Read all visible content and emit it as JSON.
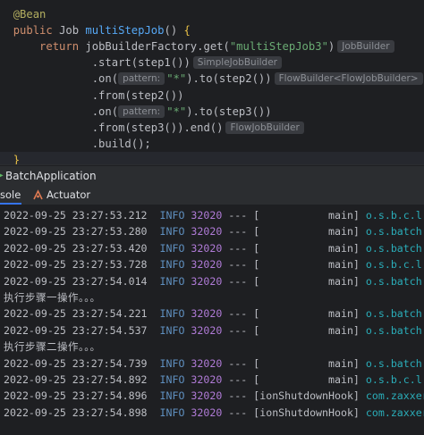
{
  "editor": {
    "lines": [
      {
        "parts": [
          {
            "t": "  ",
            "c": "id"
          },
          {
            "t": "@Bean",
            "c": "ann"
          }
        ]
      },
      {
        "parts": [
          {
            "t": "  ",
            "c": "id"
          },
          {
            "t": "public ",
            "c": "kw"
          },
          {
            "t": "Job ",
            "c": "id"
          },
          {
            "t": "multiStepJob",
            "c": "fn"
          },
          {
            "t": "() ",
            "c": "id"
          },
          {
            "t": "{",
            "c": "brk"
          }
        ]
      },
      {
        "parts": [
          {
            "t": "      ",
            "c": "id"
          },
          {
            "t": "return ",
            "c": "kw"
          },
          {
            "t": "jobBuilderFactory",
            "c": "id"
          },
          {
            "t": ".get(",
            "c": "id"
          },
          {
            "t": "\"multiStepJob3\"",
            "c": "str"
          },
          {
            "t": ")",
            "c": "id"
          },
          {
            "t": "JobBuilder",
            "c": "hint type"
          }
        ]
      },
      {
        "parts": [
          {
            "t": "              .start(step1())",
            "c": "id"
          },
          {
            "t": "SimpleJobBuilder",
            "c": "hint type"
          }
        ]
      },
      {
        "parts": [
          {
            "t": "              .on(",
            "c": "id"
          },
          {
            "t": "pattern:",
            "c": "hint param"
          },
          {
            "t": "\"*\"",
            "c": "str"
          },
          {
            "t": ").to(step2())",
            "c": "id"
          },
          {
            "t": "FlowBuilder<FlowJobBuilder>",
            "c": "hint type"
          }
        ]
      },
      {
        "parts": [
          {
            "t": "              .from(step2())",
            "c": "id"
          }
        ]
      },
      {
        "parts": [
          {
            "t": "              .on(",
            "c": "id"
          },
          {
            "t": "pattern:",
            "c": "hint param"
          },
          {
            "t": "\"*\"",
            "c": "str"
          },
          {
            "t": ").to(step3())",
            "c": "id"
          }
        ]
      },
      {
        "parts": [
          {
            "t": "              .from(step3()).end()",
            "c": "id"
          },
          {
            "t": "FlowJobBuilder",
            "c": "hint type"
          }
        ]
      },
      {
        "parts": [
          {
            "t": "              .build();",
            "c": "id"
          }
        ]
      },
      {
        "parts": [
          {
            "t": "  ",
            "c": "id"
          },
          {
            "t": "}",
            "c": "brk"
          }
        ]
      }
    ]
  },
  "run_window": {
    "title": "BatchApplication",
    "tabs": [
      {
        "label": "sole",
        "active": true
      },
      {
        "label": "Actuator",
        "active": false
      }
    ]
  },
  "console": {
    "rows": [
      {
        "type": "log",
        "ts": "2022-09-25 23:27:53.212",
        "level": "INFO",
        "pid": "32020",
        "sep": "---",
        "thread": "[           main]",
        "logger": "o.s.b.c.l.sup"
      },
      {
        "type": "log",
        "ts": "2022-09-25 23:27:53.280",
        "level": "INFO",
        "pid": "32020",
        "sep": "---",
        "thread": "[           main]",
        "logger": "o.s.batch.cor"
      },
      {
        "type": "log",
        "ts": "2022-09-25 23:27:53.420",
        "level": "INFO",
        "pid": "32020",
        "sep": "---",
        "thread": "[           main]",
        "logger": "o.s.batch.cor"
      },
      {
        "type": "log",
        "ts": "2022-09-25 23:27:53.728",
        "level": "INFO",
        "pid": "32020",
        "sep": "---",
        "thread": "[           main]",
        "logger": "o.s.b.c.l.sup"
      },
      {
        "type": "log",
        "ts": "2022-09-25 23:27:54.014",
        "level": "INFO",
        "pid": "32020",
        "sep": "---",
        "thread": "[           main]",
        "logger": "o.s.batch.cor"
      },
      {
        "type": "text",
        "text": "执行步骤一操作。。。"
      },
      {
        "type": "log",
        "ts": "2022-09-25 23:27:54.221",
        "level": "INFO",
        "pid": "32020",
        "sep": "---",
        "thread": "[           main]",
        "logger": "o.s.batch.cor"
      },
      {
        "type": "log",
        "ts": "2022-09-25 23:27:54.537",
        "level": "INFO",
        "pid": "32020",
        "sep": "---",
        "thread": "[           main]",
        "logger": "o.s.batch.cor"
      },
      {
        "type": "text",
        "text": "执行步骤二操作。。。"
      },
      {
        "type": "log",
        "ts": "2022-09-25 23:27:54.739",
        "level": "INFO",
        "pid": "32020",
        "sep": "---",
        "thread": "[           main]",
        "logger": "o.s.batch.cor"
      },
      {
        "type": "log",
        "ts": "2022-09-25 23:27:54.892",
        "level": "INFO",
        "pid": "32020",
        "sep": "---",
        "thread": "[           main]",
        "logger": "o.s.b.c.l.sup"
      },
      {
        "type": "log",
        "ts": "2022-09-25 23:27:54.896",
        "level": "INFO",
        "pid": "32020",
        "sep": "---",
        "thread": "[ionShutdownHook]",
        "logger": "com.zaxxer.hi"
      },
      {
        "type": "log",
        "ts": "2022-09-25 23:27:54.898",
        "level": "INFO",
        "pid": "32020",
        "sep": "---",
        "thread": "[ionShutdownHook]",
        "logger": "com.zaxxer.hi"
      }
    ]
  },
  "colors": {
    "editor_bg": "#1e1f22",
    "tool_bg": "#2b2d30",
    "keyword": "#cf8e6d",
    "string": "#6aab73",
    "method": "#56a8f5",
    "info_level": "#5f8fbf",
    "pid": "#b07bd7",
    "logger": "#2aacb8",
    "active_tab": "#3574f0"
  },
  "icons": {
    "run": "run-icon",
    "actuator": "actuator-icon"
  }
}
